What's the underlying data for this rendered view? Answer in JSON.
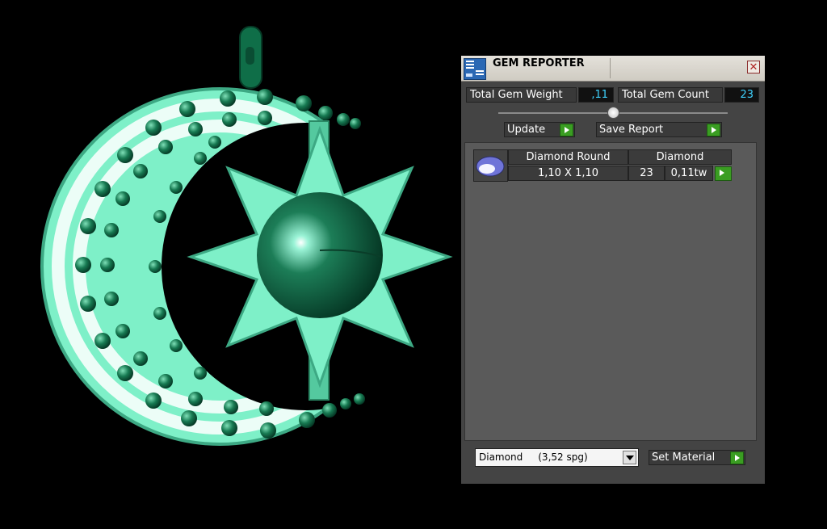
{
  "panel": {
    "title": "GEM REPORTER",
    "close_label": "✕",
    "total_weight_label": "Total Gem Weight",
    "total_weight_value": ",11",
    "total_count_label": "Total Gem Count",
    "total_count_value": "23",
    "update_label": "Update",
    "save_report_label": "Save Report",
    "gems": [
      {
        "name": "Diamond Round",
        "material": "Diamond",
        "size": "1,10 X 1,10",
        "count": "23",
        "weight": "0,11tw"
      }
    ],
    "material_select": "Diamond     (3,52 spg)",
    "set_material_label": "Set Material"
  },
  "colors": {
    "jewel_green": "#7ef0c8",
    "gem_dark_green": "#0d6b46",
    "accent_cyan": "#3fd3ff",
    "go_green": "#3a9d22"
  }
}
